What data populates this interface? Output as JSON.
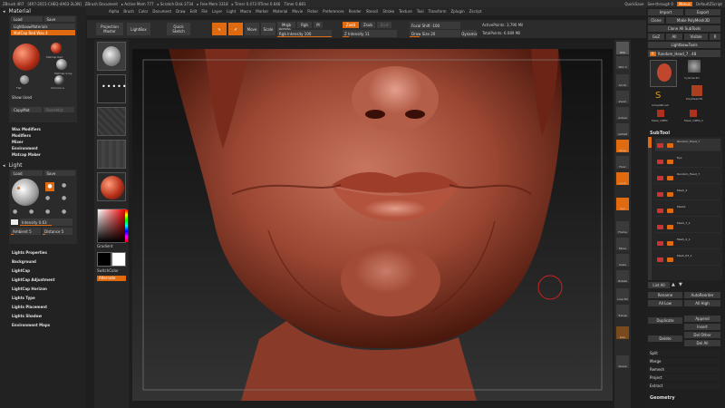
{
  "titlebar": {
    "app": "ZBrush 4R7",
    "items": [
      "[4R7-2015-CHEQ-4A63-3L3N]",
      "ZBrush Document",
      "▸ Active Mem 777",
      "▸ Scratch Disk 2734",
      "▸ Free Mem 3318",
      "▸ Timer 0.473 RTime 0.646",
      "Timer 0.881"
    ],
    "quicksave": "QuickSave",
    "seethrough": "See-through 0",
    "menus": "Menus",
    "default_script": "DefaultZScript"
  },
  "menubar": [
    "Alpha",
    "Brush",
    "Color",
    "Document",
    "Draw",
    "Edit",
    "File",
    "Layer",
    "Light",
    "Macro",
    "Marker",
    "Material",
    "Movie",
    "Picker",
    "Preferences",
    "Render",
    "Stencil",
    "Stroke",
    "Texture",
    "Tool",
    "Transform",
    "Zplugin",
    "Zscript"
  ],
  "left": {
    "material_title": "Material",
    "load": "Load",
    "save": "Save",
    "lightbox_materials": "Lightbox▸Materials",
    "matcap_label": "MatCap Red Wax 4",
    "mat_names": [
      "MatCap Red",
      "MatCap Gray",
      "BasicMaterial",
      "Flat",
      "Chrome A"
    ],
    "show_used": "Show Used",
    "copymat": "CopyMat",
    "pastemat": "PasteMat",
    "subsections": [
      "Wax Modifiers",
      "Modifiers",
      "Mixer",
      "Environment",
      "Matcap Maker"
    ],
    "light_title": "Light",
    "intensity": "Intensity 0.63",
    "ambient": "Ambient 5",
    "distance": "Distance 5",
    "light_sections": [
      "Lights Properties",
      "Background",
      "LightCap",
      "LightCap Adjustment",
      "LightCap Horizon",
      "Lights Type",
      "Lights Placement",
      "Lights Shadow",
      "Environment Maps"
    ]
  },
  "shelf": {
    "projection_master": "Projection Master",
    "lightbox": "LightBox",
    "quick_sketch": "Quick Sketch",
    "edit": "Edit",
    "draw": "Draw",
    "move": "Move",
    "scale": "Scale",
    "rotate": "Rotate",
    "mrgb": "Mrgb",
    "rgb": "Rgb",
    "m": "M",
    "rgb_intensity": "Rgb Intensity 100",
    "zadd": "Zadd",
    "zsub": "Zsub",
    "zcut": "Zcut",
    "z_intensity": "Z Intensity 11",
    "focal_shift": "Focal Shift -100",
    "draw_size": "Draw Size 20",
    "dynamic": "Dynamic",
    "active_points": "ActivePoints: 3,790 Mil",
    "total_points": "TotalPoints: 6.089 Mil"
  },
  "tray": {
    "gradient": "Gradient",
    "switchcolor": "SwitchColor",
    "alternate": "Alternate"
  },
  "strip": [
    "BPR",
    "SPix 3",
    "Scroll",
    "Zoom",
    "Actual",
    "AAHalf",
    "Persp",
    "Floor",
    "Local",
    "Xyz",
    "Frame",
    "Move",
    "Scale",
    "Rotate",
    "Line Fill",
    "Transp",
    "Solo",
    "Xpose"
  ],
  "right": {
    "import": "Import",
    "export": "Export",
    "clone": "Clone",
    "make_polymesh": "Make PolyMesh3D",
    "clone_all": "Clone All SubTools",
    "goz": "GoZ",
    "all": "All",
    "visible": "Visible",
    "r": "R",
    "lightbox_tools": "Lightbox▸Tools",
    "random_head": "Random_Head_7 . 48",
    "tool_names": [
      "Random_H",
      "Cylinder3D",
      "PolyMesh3D",
      "SimpleBrush",
      "Mask_OPEN",
      "Mask_OPEN_2"
    ],
    "subtool": "SubTool",
    "subtools": [
      "Random_Head_7",
      "Eye",
      "Random_Head_7",
      "Mesh_2",
      "Mesh1",
      "Mesh_7_1",
      "Mesh_2_1",
      "Mesh_P3_1"
    ],
    "list_all": "List All",
    "rename": "Rename",
    "autoreorder": "AutoReorder",
    "all_low": "All Low",
    "all_high": "All High",
    "duplicate": "Duplicate",
    "append": "Append",
    "insert": "Insert",
    "delete": "Delete",
    "del_other": "Del Other",
    "del_all": "Del All",
    "split": "Split",
    "merge": "Merge",
    "remesh": "Remesh",
    "project": "Project",
    "extract": "Extract",
    "geometry": "Geometry"
  }
}
